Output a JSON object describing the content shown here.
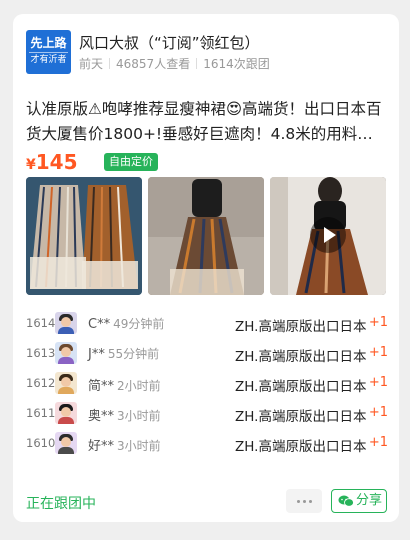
{
  "header": {
    "avatar_line1": "先上路",
    "avatar_line2": "才有沂者",
    "shop_name": "风口大叔（“订阅”领红包）",
    "posted": "前天",
    "views": "46857人查看",
    "follows": "1614次跟团"
  },
  "product": {
    "title": "认准原版⚠咆哮推荐显瘦神裙😍高端货！出口日本百货大厦售价1800+!垂感好巨遮肉！4.8米的用料…",
    "currency": "¥",
    "price": "145",
    "tag": "自由定价",
    "photos": [
      "pleated-skirt-flatlay",
      "model-wearing-skirt",
      "mirror-selfie-video"
    ]
  },
  "orders": [
    {
      "no": "1614",
      "user": "C**",
      "time": "49分钟前",
      "item": "ZH.高端原版出口日本",
      "qty": "+1"
    },
    {
      "no": "1613",
      "user": "J**",
      "time": "55分钟前",
      "item": "ZH.高端原版出口日本",
      "qty": "+1"
    },
    {
      "no": "1612",
      "user": "简**",
      "time": "2小时前",
      "item": "ZH.高端原版出口日本",
      "qty": "+1"
    },
    {
      "no": "1611",
      "user": "奥**",
      "time": "3小时前",
      "item": "ZH.高端原版出口日本",
      "qty": "+1"
    },
    {
      "no": "1610",
      "user": "好**",
      "time": "3小时前",
      "item": "ZH.高端原版出口日本",
      "qty": "+1"
    }
  ],
  "footer": {
    "status": "正在跟团中",
    "share_label": "分享"
  },
  "colors": {
    "accent_green": "#27b35a",
    "price_orange": "#ff5722",
    "avatar_blue": "#1f6fd6"
  }
}
